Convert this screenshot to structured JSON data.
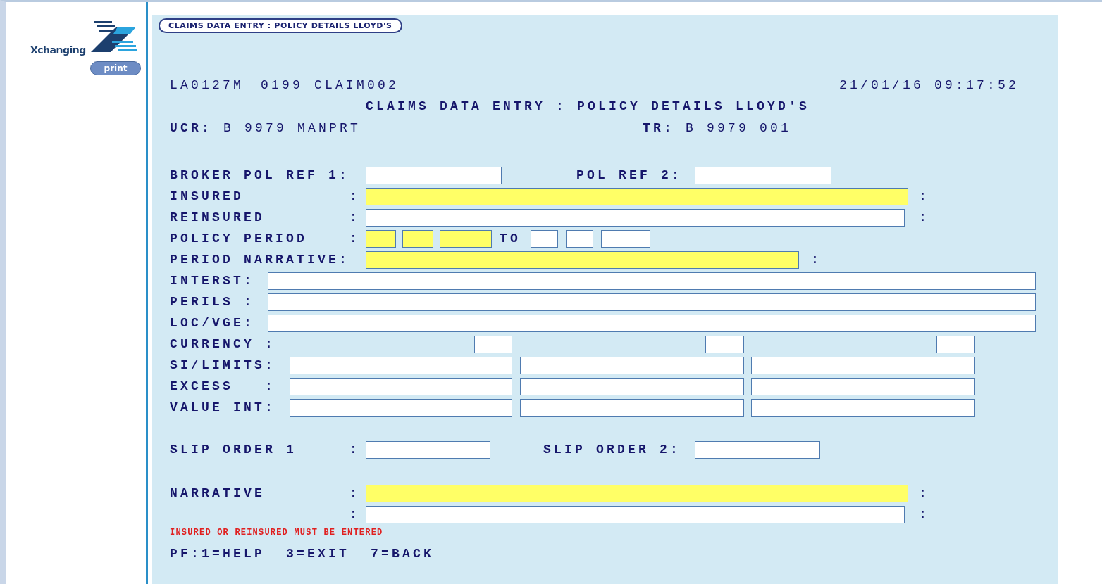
{
  "sidebar": {
    "logo_text": "Xchanging",
    "print_button": "print"
  },
  "screen_tab": "CLAIMS DATA ENTRY : POLICY DETAILS LLOYD'S",
  "header": {
    "program": "LA0127M",
    "code": "0199",
    "screen_id": "CLAIM002",
    "datetime": "21/01/16 09:17:52"
  },
  "title": "CLAIMS DATA ENTRY : POLICY DETAILS LLOYD'S",
  "ucr": {
    "label": "UCR:",
    "value": "B 9979 MANPRT"
  },
  "tr": {
    "label": "TR:",
    "value": "B 9979 001"
  },
  "rows": [
    {
      "kind": "ref",
      "label": "BROKER POL REF 1:",
      "label_2": "POL REF 2:",
      "fields": [
        {
          "required": false
        },
        {
          "required": false
        }
      ]
    },
    {
      "kind": "wide",
      "label": "INSURED          :",
      "fields": [
        {
          "required": true
        }
      ],
      "trailing": ":"
    },
    {
      "kind": "wide2",
      "label": "REINSURED        :",
      "fields": [
        {
          "required": false
        }
      ],
      "trailing": ":"
    },
    {
      "kind": "period",
      "label": "POLICY PERIOD    :",
      "between": "TO",
      "fields": [
        {
          "required": true
        },
        {
          "required": true
        },
        {
          "required": true
        },
        {
          "required": false
        },
        {
          "required": false
        },
        {
          "required": false
        }
      ]
    },
    {
      "kind": "narr",
      "label": "PERIOD NARRATIVE:",
      "fields": [
        {
          "required": true
        }
      ],
      "trailing": ":"
    },
    {
      "kind": "full",
      "label": "INTERST:",
      "fields": [
        {
          "required": false
        }
      ]
    },
    {
      "kind": "full",
      "label": "PERILS :",
      "fields": [
        {
          "required": false
        }
      ]
    },
    {
      "kind": "full",
      "label": "LOC/VGE:",
      "fields": [
        {
          "required": false
        }
      ]
    },
    {
      "kind": "currency",
      "label": "CURRENCY :",
      "fields": [
        {
          "required": false
        },
        {
          "required": false
        },
        {
          "required": false
        }
      ]
    },
    {
      "kind": "triple",
      "label": "SI/LIMITS:",
      "fields": [
        {
          "required": false
        },
        {
          "required": false
        },
        {
          "required": false
        }
      ]
    },
    {
      "kind": "triple",
      "label": "EXCESS   :",
      "fields": [
        {
          "required": false
        },
        {
          "required": false
        },
        {
          "required": false
        }
      ]
    },
    {
      "kind": "triple",
      "label": "VALUE INT:",
      "fields": [
        {
          "required": false
        },
        {
          "required": false
        },
        {
          "required": false
        }
      ]
    },
    {
      "kind": "slip",
      "label": "SLIP ORDER 1     :",
      "label_2": "SLIP ORDER 2:",
      "fields": [
        {
          "required": false
        },
        {
          "required": false
        }
      ]
    },
    {
      "kind": "narrative",
      "label": "NARRATIVE        :",
      "fields": [
        {
          "required": true
        }
      ],
      "trailing": ":"
    },
    {
      "kind": "wide2",
      "label": "                 :",
      "fields": [
        {
          "required": false
        }
      ],
      "trailing": ":"
    }
  ],
  "message": "INSURED OR REINSURED MUST BE ENTERED",
  "pf_keys": "PF:1=HELP  3=EXIT  7=BACK"
}
